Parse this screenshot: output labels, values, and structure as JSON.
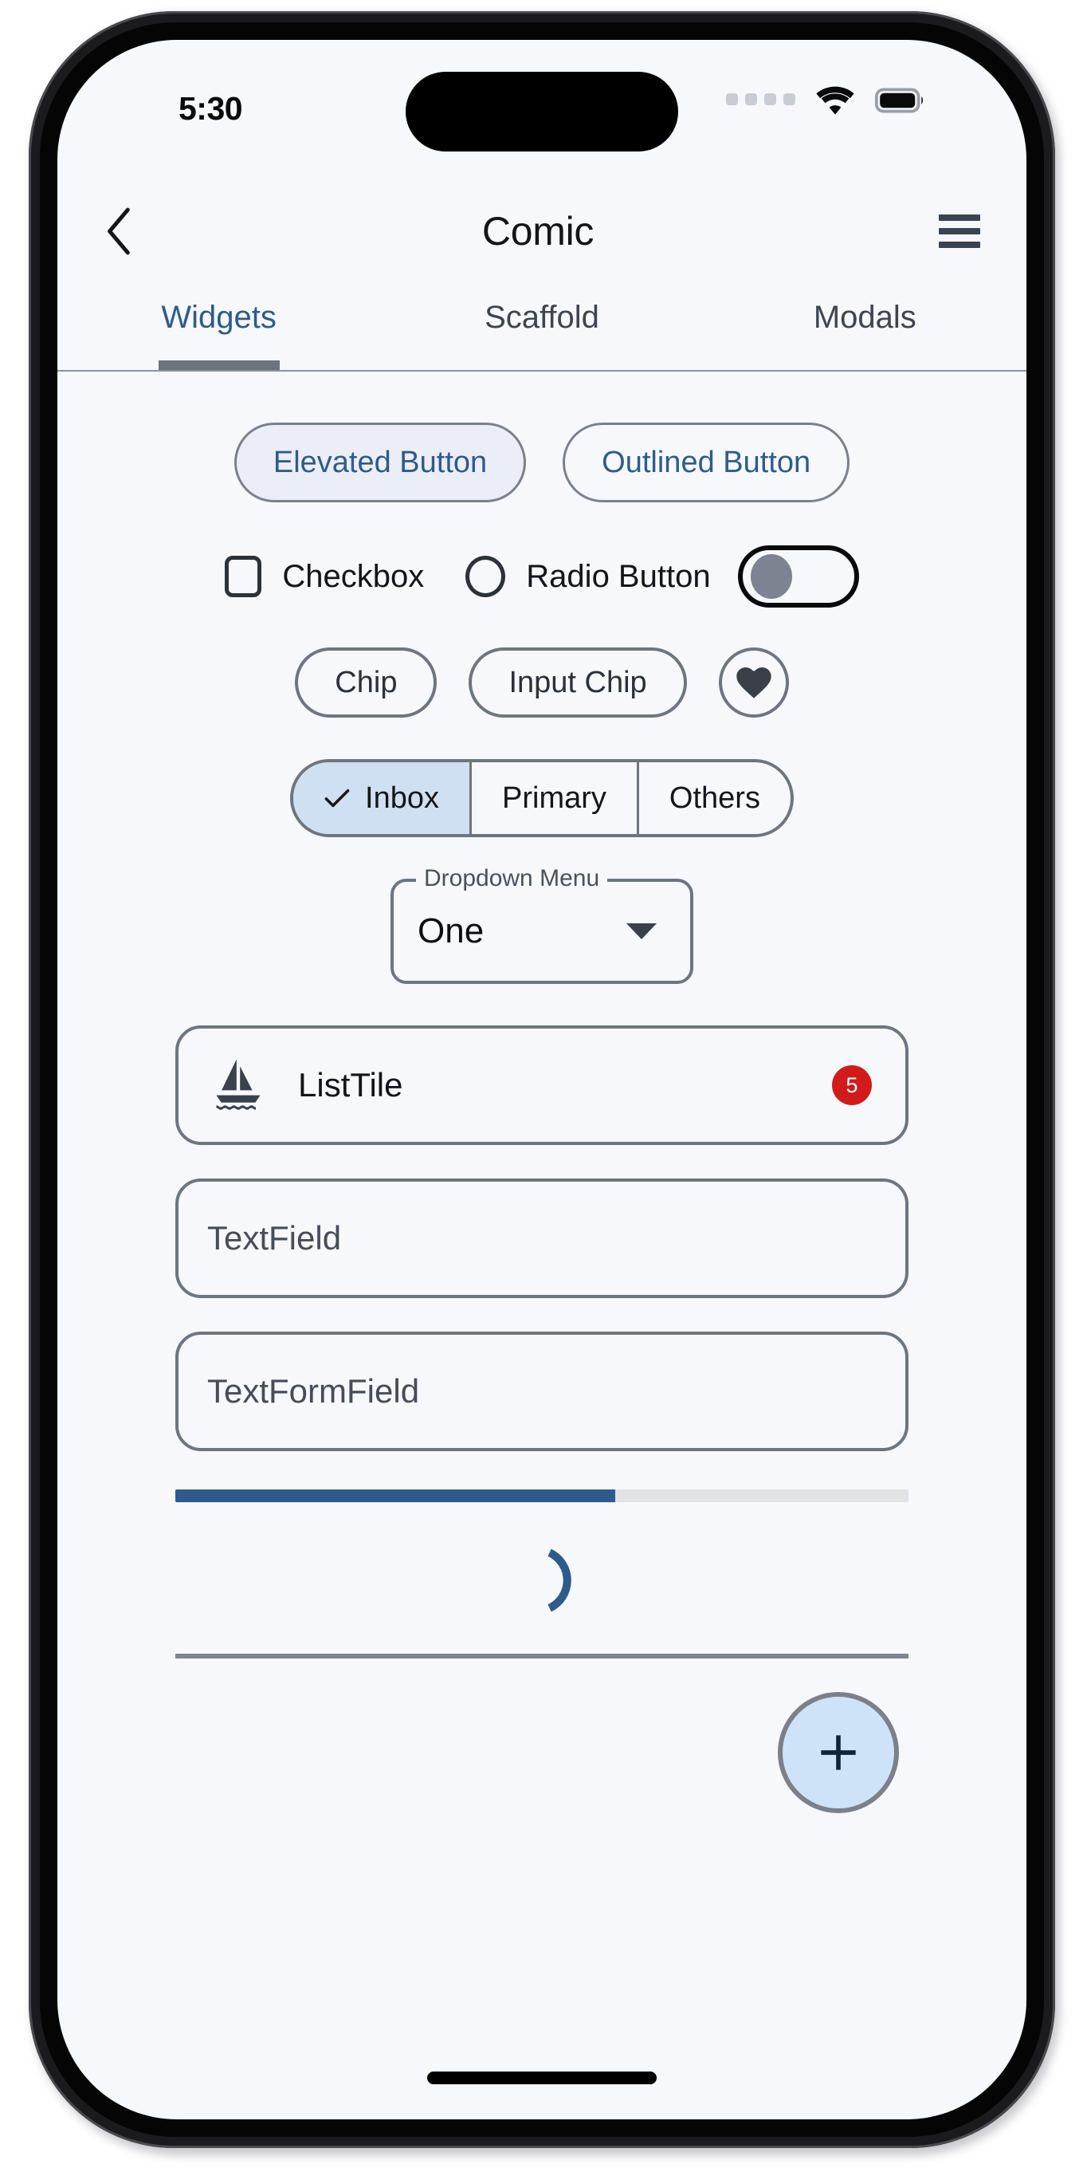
{
  "status_bar": {
    "time": "5:30",
    "icons": [
      "cellular-dots-icon",
      "wifi-icon",
      "battery-full-icon"
    ],
    "battery_level": "full",
    "signal_dots": 4
  },
  "app_bar": {
    "back_icon": "chevron-left-icon",
    "title": "Comic",
    "menu_icon": "hamburger-menu-icon"
  },
  "tabs": {
    "active_index": 0,
    "items": [
      {
        "label": "Widgets"
      },
      {
        "label": "Scaffold"
      },
      {
        "label": "Modals"
      }
    ]
  },
  "widgets": {
    "buttons": {
      "elevated_label": "Elevated Button",
      "outlined_label": "Outlined Button"
    },
    "selection": {
      "checkbox_label": "Checkbox",
      "checkbox_checked": false,
      "radio_label": "Radio Button",
      "radio_selected": false,
      "switch_on": false
    },
    "chips": {
      "chip_label": "Chip",
      "input_chip_label": "Input Chip",
      "icon_chip": "heart-icon"
    },
    "segmented": {
      "selected_index": 0,
      "items": [
        {
          "label": "Inbox"
        },
        {
          "label": "Primary"
        },
        {
          "label": "Others"
        }
      ]
    },
    "dropdown": {
      "label": "Dropdown Menu",
      "value": "One",
      "caret_icon": "chevron-down-icon"
    },
    "list_tile": {
      "leading_icon": "sailboat-icon",
      "title": "ListTile",
      "badge_count": "5",
      "badge_color": "#d01b1b"
    },
    "text_field": {
      "placeholder": "TextField",
      "value": ""
    },
    "text_form_field": {
      "placeholder": "TextFormField",
      "value": ""
    },
    "linear_progress": {
      "percent": 60,
      "fill_color": "#2f5b8c",
      "track_color": "#e2e3e5"
    },
    "circular_progress": {
      "indeterminate": true,
      "color": "#2f5b8c"
    },
    "fab": {
      "icon": "plus-icon",
      "background": "#cfe3f8"
    }
  },
  "theme": {
    "accent": "#2f5b8c",
    "surface": "#f6f8fc",
    "outline": "#6f757f",
    "selected_fill": "#cfe0f2"
  }
}
